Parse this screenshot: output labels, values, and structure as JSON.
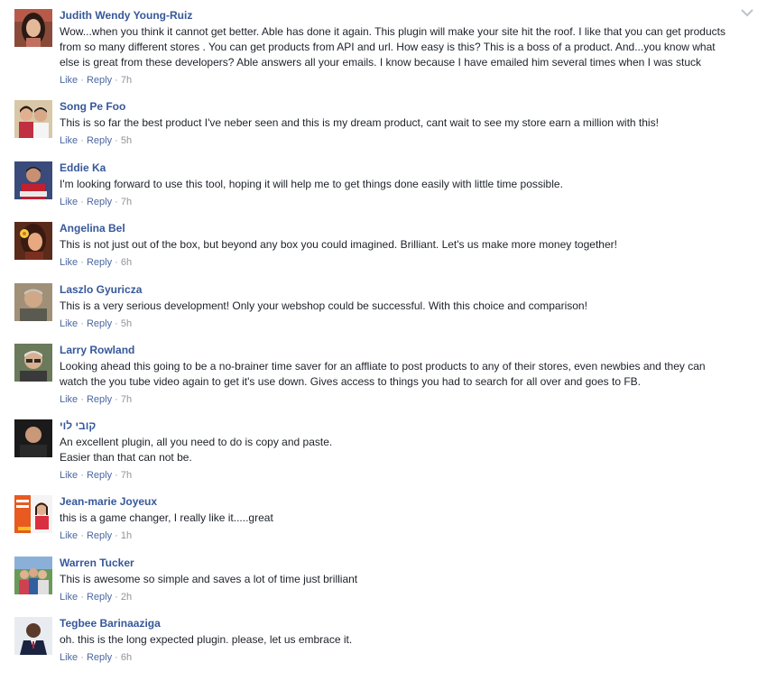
{
  "comments": [
    {
      "author": "Judith Wendy Young-Ruiz",
      "avatar_icon": "avatar-woman-dark-hair",
      "text_lines": [
        "Wow...when you think it cannot get better. Able has done it again. This plugin will make your site hit the roof. I like that you can get products",
        "from so many different stores . You can get products from API and url. How easy is this? This is a boss of a product. And...you know what",
        "else is great from these developers? Able answers all your emails. I know because I have emailed him several times when I was stuck"
      ],
      "like": "Like",
      "reply": "Reply",
      "time": "7h"
    },
    {
      "author": "Song Pe Foo",
      "avatar_icon": "avatar-couple",
      "text_lines": [
        "This is so far the best product I've neber seen and this is my dream product, cant wait to see my store earn a million with this!"
      ],
      "like": "Like",
      "reply": "Reply",
      "time": "5h"
    },
    {
      "author": "Eddie Ka",
      "avatar_icon": "avatar-man-red-shirt",
      "text_lines": [
        "I'm looking forward to use this tool, hoping it will help me to get things done easily with little time possible."
      ],
      "like": "Like",
      "reply": "Reply",
      "time": "7h"
    },
    {
      "author": "Angelina Bel",
      "avatar_icon": "avatar-woman-flower",
      "text_lines": [
        "This is not just out of the box, but beyond any box you could imagined. Brilliant. Let's us make more money together!"
      ],
      "like": "Like",
      "reply": "Reply",
      "time": "6h"
    },
    {
      "author": "Laszlo Gyuricza",
      "avatar_icon": "avatar-older-man",
      "text_lines": [
        "This is a very serious development! Only your webshop could be successful. With this choice and comparison!"
      ],
      "like": "Like",
      "reply": "Reply",
      "time": "5h"
    },
    {
      "author": "Larry Rowland",
      "avatar_icon": "avatar-man-glasses",
      "text_lines": [
        "Looking ahead this going to be a no-brainer time saver for an affliate to post products to any of their stores, even newbies and they can",
        "watch the you tube video again to get it's use down. Gives access to things you had to search for all over and goes to FB."
      ],
      "like": "Like",
      "reply": "Reply",
      "time": "7h"
    },
    {
      "author": "קובי לוי",
      "avatar_icon": "avatar-man-dark-background",
      "text_lines": [
        "An excellent plugin, all you need to do is copy and paste.",
        "Easier than that can not be."
      ],
      "like": "Like",
      "reply": "Reply",
      "time": "7h"
    },
    {
      "author": "Jean-marie Joyeux",
      "avatar_icon": "avatar-ad-banner",
      "text_lines": [
        "this is a game changer, I really like it.....great"
      ],
      "like": "Like",
      "reply": "Reply",
      "time": "1h"
    },
    {
      "author": "Warren Tucker",
      "avatar_icon": "avatar-group-outdoors",
      "text_lines": [
        "This is awesome so simple and saves a lot of time just brilliant"
      ],
      "like": "Like",
      "reply": "Reply",
      "time": "2h"
    },
    {
      "author": "Tegbee Barinaaziga",
      "avatar_icon": "avatar-man-suit",
      "text_lines": [
        "oh. this is the long expected plugin. please, let us embrace it."
      ],
      "like": "Like",
      "reply": "Reply",
      "time": "6h"
    }
  ],
  "separator": "·",
  "colors": {
    "author": "#365899",
    "text": "#1d2129",
    "meta": "#90949c",
    "link": "#4b67a1"
  }
}
